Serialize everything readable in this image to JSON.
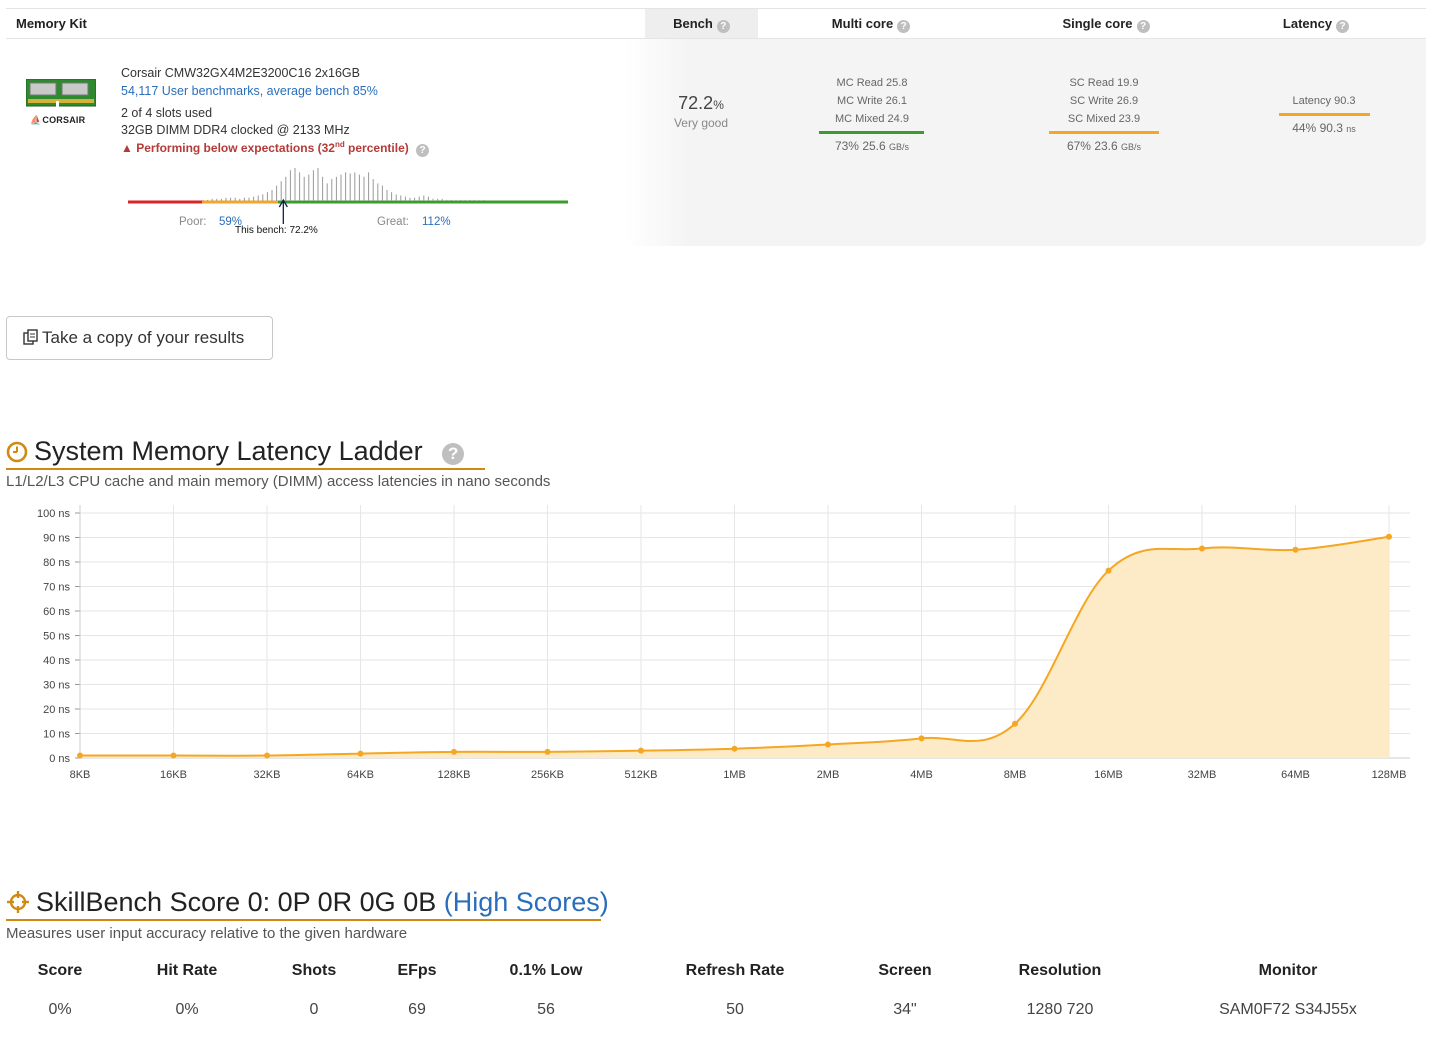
{
  "kit_table": {
    "headers": {
      "kit": "Memory Kit",
      "bench": "Bench",
      "multi": "Multi core",
      "single": "Single core",
      "latency": "Latency"
    },
    "help_glyph": "?",
    "kit": {
      "name": "Corsair CMW32GX4M2E3200C16 2x16GB",
      "benchmarks_link": "54,117 User benchmarks, average bench 85%",
      "slots": "2 of 4 slots used",
      "dimm": "32GB DIMM DDR4 clocked @ 2133 MHz",
      "warning_prefix": "Performing below expectations (32",
      "warning_sup": "nd",
      "warning_suffix": " percentile)",
      "brand": "CORSAIR",
      "poor_label": "Poor:",
      "poor_value": "59%",
      "great_label": "Great:",
      "great_value": "112%",
      "this_bench": "This bench: 72.2%",
      "this_bench_position": 0.353,
      "distribution": [
        1,
        1,
        2,
        2,
        2,
        3,
        3,
        3,
        2,
        3,
        3,
        4,
        5,
        6,
        8,
        10,
        14,
        18,
        22,
        28,
        30,
        26,
        22,
        24,
        28,
        30,
        22,
        16,
        20,
        22,
        24,
        26,
        25,
        26,
        24,
        22,
        26,
        20,
        16,
        14,
        10,
        8,
        6,
        5,
        4,
        3,
        3,
        4,
        5,
        4,
        2,
        2,
        2,
        1,
        1,
        1,
        1,
        1,
        1,
        1,
        1,
        1
      ]
    },
    "bench": {
      "value": "72.2",
      "unit": "%",
      "desc": "Very good"
    },
    "multi": {
      "lines": [
        "MC Read 25.8",
        "MC Write 26.1",
        "MC Mixed 24.9"
      ],
      "result_pct": "73%",
      "result_val": "25.6",
      "result_unit": "GB/s",
      "bar_color": "#3a9c2c"
    },
    "single": {
      "lines": [
        "SC Read 19.9",
        "SC Write 26.9",
        "SC Mixed 23.9"
      ],
      "result_pct": "67%",
      "result_val": "23.6",
      "result_unit": "GB/s",
      "bar_color": "#f5a623"
    },
    "latency": {
      "line": "Latency 90.3",
      "result_pct": "44%",
      "result_val": "90.3",
      "result_unit": "ns",
      "bar_color": "#f5a623"
    }
  },
  "copy_button": {
    "label": "Take a copy of your results",
    "icon": "copy-icon"
  },
  "latency_section": {
    "title": "System Memory Latency Ladder",
    "subtitle": "L1/L2/L3 CPU cache and main memory (DIMM) access latencies in nano seconds",
    "icon": "clock-icon",
    "help_glyph": "?"
  },
  "chart_data": {
    "type": "area",
    "title": "System Memory Latency Ladder",
    "categories": [
      "8KB",
      "16KB",
      "32KB",
      "64KB",
      "128KB",
      "256KB",
      "512KB",
      "1MB",
      "2MB",
      "4MB",
      "8MB",
      "16MB",
      "32MB",
      "64MB",
      "128MB"
    ],
    "y_ticks": [
      "0 ns",
      "10 ns",
      "20 ns",
      "30 ns",
      "40 ns",
      "50 ns",
      "60 ns",
      "70 ns",
      "80 ns",
      "90 ns",
      "100 ns"
    ],
    "ylim": [
      0,
      100
    ],
    "y_unit": "ns",
    "series": [
      {
        "values": [
          1.0,
          1.0,
          1.0,
          1.8,
          2.5,
          2.5,
          3.0,
          3.8,
          5.5,
          8.0,
          14.0,
          76.5,
          85.5,
          85.0,
          90.3
        ]
      }
    ],
    "line_color": "#f5a623",
    "fill_color": "#fdebc8",
    "grid": true
  },
  "skill_section": {
    "title": "SkillBench Score 0: 0P 0R 0G 0B",
    "title_link": "(High Scores)",
    "subtitle": "Measures user input accuracy relative to the given hardware",
    "icon": "crosshair-icon",
    "headers": [
      "Score",
      "Hit Rate",
      "Shots",
      "EFps",
      "0.1% Low",
      "Refresh Rate",
      "Screen",
      "Resolution",
      "Monitor"
    ],
    "values": [
      "0%",
      "0%",
      "0",
      "69",
      "56",
      "50",
      "34\"",
      "1280 720",
      "SAM0F72 S34J55x"
    ]
  }
}
